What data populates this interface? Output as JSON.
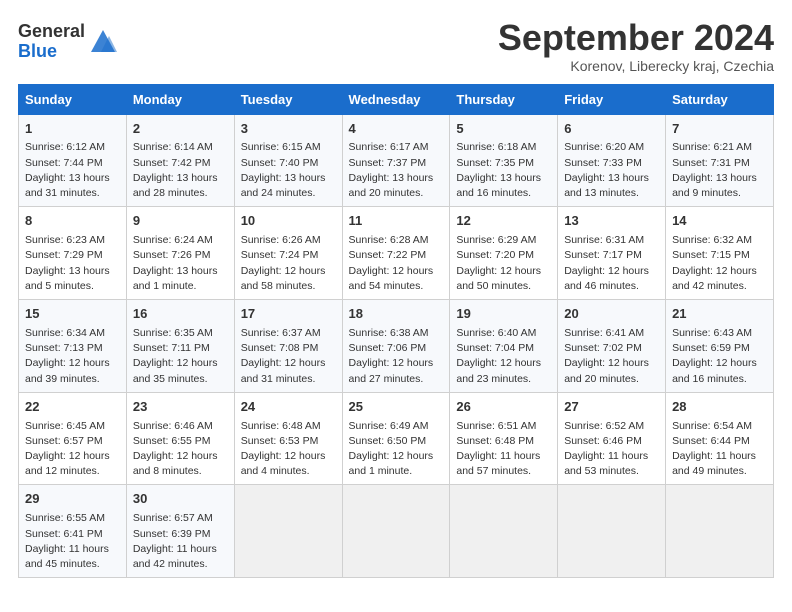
{
  "header": {
    "logo_general": "General",
    "logo_blue": "Blue",
    "month_title": "September 2024",
    "subtitle": "Korenov, Liberecky kraj, Czechia"
  },
  "weekdays": [
    "Sunday",
    "Monday",
    "Tuesday",
    "Wednesday",
    "Thursday",
    "Friday",
    "Saturday"
  ],
  "weeks": [
    [
      {
        "day": "1",
        "info": "Sunrise: 6:12 AM\nSunset: 7:44 PM\nDaylight: 13 hours\nand 31 minutes."
      },
      {
        "day": "2",
        "info": "Sunrise: 6:14 AM\nSunset: 7:42 PM\nDaylight: 13 hours\nand 28 minutes."
      },
      {
        "day": "3",
        "info": "Sunrise: 6:15 AM\nSunset: 7:40 PM\nDaylight: 13 hours\nand 24 minutes."
      },
      {
        "day": "4",
        "info": "Sunrise: 6:17 AM\nSunset: 7:37 PM\nDaylight: 13 hours\nand 20 minutes."
      },
      {
        "day": "5",
        "info": "Sunrise: 6:18 AM\nSunset: 7:35 PM\nDaylight: 13 hours\nand 16 minutes."
      },
      {
        "day": "6",
        "info": "Sunrise: 6:20 AM\nSunset: 7:33 PM\nDaylight: 13 hours\nand 13 minutes."
      },
      {
        "day": "7",
        "info": "Sunrise: 6:21 AM\nSunset: 7:31 PM\nDaylight: 13 hours\nand 9 minutes."
      }
    ],
    [
      {
        "day": "8",
        "info": "Sunrise: 6:23 AM\nSunset: 7:29 PM\nDaylight: 13 hours\nand 5 minutes."
      },
      {
        "day": "9",
        "info": "Sunrise: 6:24 AM\nSunset: 7:26 PM\nDaylight: 13 hours\nand 1 minute."
      },
      {
        "day": "10",
        "info": "Sunrise: 6:26 AM\nSunset: 7:24 PM\nDaylight: 12 hours\nand 58 minutes."
      },
      {
        "day": "11",
        "info": "Sunrise: 6:28 AM\nSunset: 7:22 PM\nDaylight: 12 hours\nand 54 minutes."
      },
      {
        "day": "12",
        "info": "Sunrise: 6:29 AM\nSunset: 7:20 PM\nDaylight: 12 hours\nand 50 minutes."
      },
      {
        "day": "13",
        "info": "Sunrise: 6:31 AM\nSunset: 7:17 PM\nDaylight: 12 hours\nand 46 minutes."
      },
      {
        "day": "14",
        "info": "Sunrise: 6:32 AM\nSunset: 7:15 PM\nDaylight: 12 hours\nand 42 minutes."
      }
    ],
    [
      {
        "day": "15",
        "info": "Sunrise: 6:34 AM\nSunset: 7:13 PM\nDaylight: 12 hours\nand 39 minutes."
      },
      {
        "day": "16",
        "info": "Sunrise: 6:35 AM\nSunset: 7:11 PM\nDaylight: 12 hours\nand 35 minutes."
      },
      {
        "day": "17",
        "info": "Sunrise: 6:37 AM\nSunset: 7:08 PM\nDaylight: 12 hours\nand 31 minutes."
      },
      {
        "day": "18",
        "info": "Sunrise: 6:38 AM\nSunset: 7:06 PM\nDaylight: 12 hours\nand 27 minutes."
      },
      {
        "day": "19",
        "info": "Sunrise: 6:40 AM\nSunset: 7:04 PM\nDaylight: 12 hours\nand 23 minutes."
      },
      {
        "day": "20",
        "info": "Sunrise: 6:41 AM\nSunset: 7:02 PM\nDaylight: 12 hours\nand 20 minutes."
      },
      {
        "day": "21",
        "info": "Sunrise: 6:43 AM\nSunset: 6:59 PM\nDaylight: 12 hours\nand 16 minutes."
      }
    ],
    [
      {
        "day": "22",
        "info": "Sunrise: 6:45 AM\nSunset: 6:57 PM\nDaylight: 12 hours\nand 12 minutes."
      },
      {
        "day": "23",
        "info": "Sunrise: 6:46 AM\nSunset: 6:55 PM\nDaylight: 12 hours\nand 8 minutes."
      },
      {
        "day": "24",
        "info": "Sunrise: 6:48 AM\nSunset: 6:53 PM\nDaylight: 12 hours\nand 4 minutes."
      },
      {
        "day": "25",
        "info": "Sunrise: 6:49 AM\nSunset: 6:50 PM\nDaylight: 12 hours\nand 1 minute."
      },
      {
        "day": "26",
        "info": "Sunrise: 6:51 AM\nSunset: 6:48 PM\nDaylight: 11 hours\nand 57 minutes."
      },
      {
        "day": "27",
        "info": "Sunrise: 6:52 AM\nSunset: 6:46 PM\nDaylight: 11 hours\nand 53 minutes."
      },
      {
        "day": "28",
        "info": "Sunrise: 6:54 AM\nSunset: 6:44 PM\nDaylight: 11 hours\nand 49 minutes."
      }
    ],
    [
      {
        "day": "29",
        "info": "Sunrise: 6:55 AM\nSunset: 6:41 PM\nDaylight: 11 hours\nand 45 minutes."
      },
      {
        "day": "30",
        "info": "Sunrise: 6:57 AM\nSunset: 6:39 PM\nDaylight: 11 hours\nand 42 minutes."
      },
      {
        "day": "",
        "info": ""
      },
      {
        "day": "",
        "info": ""
      },
      {
        "day": "",
        "info": ""
      },
      {
        "day": "",
        "info": ""
      },
      {
        "day": "",
        "info": ""
      }
    ]
  ]
}
